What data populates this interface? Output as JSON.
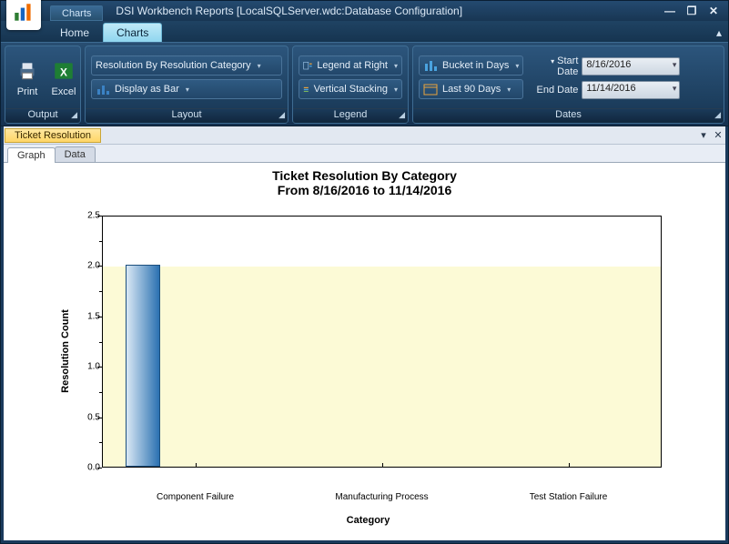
{
  "window": {
    "title": "DSI Workbench Reports [LocalSQLServer.wdc:Database Configuration]",
    "quick_tab": "Charts",
    "min": "—",
    "restore": "❐",
    "close": "✕"
  },
  "tabs": {
    "home": "Home",
    "charts": "Charts"
  },
  "ribbon": {
    "output": {
      "print": "Print",
      "excel": "Excel",
      "label": "Output"
    },
    "layout": {
      "resolution": "Resolution By Resolution Category",
      "display": "Display as Bar",
      "label": "Layout"
    },
    "legend": {
      "legend_at": "Legend at Right",
      "stacking": "Vertical Stacking",
      "label": "Legend"
    },
    "dates": {
      "bucket": "Bucket in Days",
      "last90": "Last 90 Days",
      "start_label": "Start Date",
      "end_label": "End Date",
      "start": "8/16/2016",
      "end": "11/14/2016",
      "label": "Dates"
    }
  },
  "dock": {
    "tab": "Ticket Resolution",
    "graph": "Graph",
    "data": "Data"
  },
  "chart": {
    "title": "Ticket Resolution By Category",
    "subtitle": "From 8/16/2016 to 11/14/2016",
    "xlabel": "Category",
    "ylabel": "Resolution Count"
  },
  "chart_data": {
    "type": "bar",
    "categories": [
      "Component Failure",
      "Manufacturing Process",
      "Test Station Failure"
    ],
    "values": [
      2.0,
      0.0,
      0.0
    ],
    "title": "Ticket Resolution By Category",
    "subtitle": "From 8/16/2016 to 11/14/2016",
    "xlabel": "Category",
    "ylabel": "Resolution Count",
    "ylim": [
      0.0,
      2.5
    ],
    "yticks": [
      0.0,
      0.5,
      1.0,
      1.5,
      2.0,
      2.5
    ],
    "legend": null
  }
}
